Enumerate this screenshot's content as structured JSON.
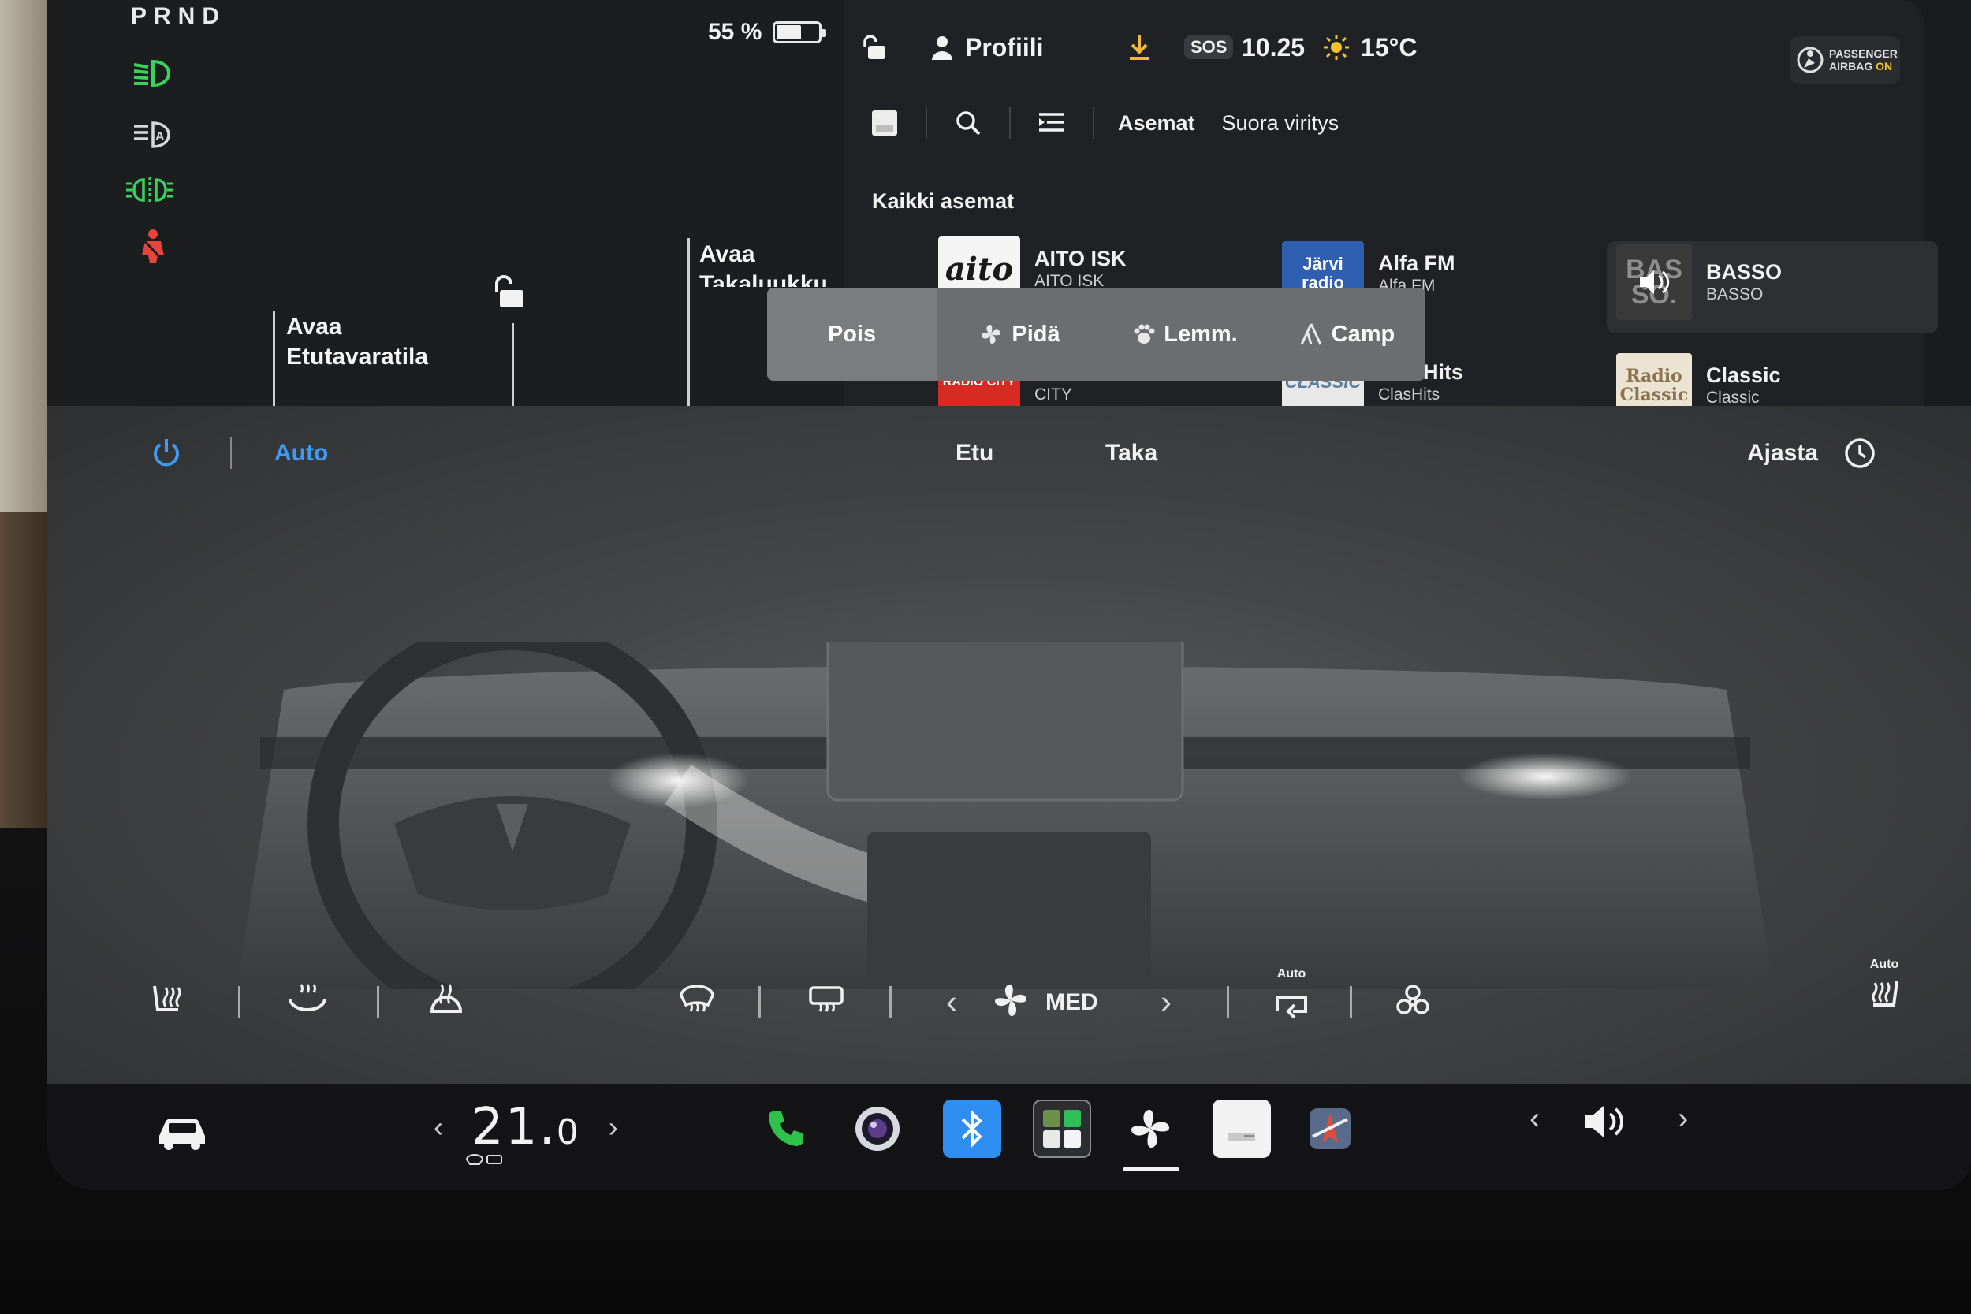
{
  "gear": "PRND",
  "battery": {
    "percent_label": "55 %",
    "level": 0.55
  },
  "status_bar": {
    "profile_label": "Profiili",
    "sos_label": "SOS",
    "time": "10.25",
    "temperature": "15°C",
    "airbag_line1": "PASSENGER",
    "airbag_line2_prefix": "AIRBAG",
    "airbag_line2_state": "ON"
  },
  "car": {
    "frunk_label": "Avaa Etutavaratila",
    "trunk_label": "Avaa Takaluukku"
  },
  "media": {
    "tabs": [
      "Asemat",
      "Suora viritys"
    ],
    "section_title": "Kaikki asemat",
    "stations": [
      {
        "name": "AITO ISK",
        "sub": "AITO ISK",
        "logo": "aito"
      },
      {
        "name": "Alfa FM",
        "sub": "Alfa FM",
        "logo": "Järvi radio"
      },
      {
        "name": "BASSO",
        "sub": "BASSO",
        "logo": "BAS SO."
      },
      {
        "name": "CITY",
        "sub": "CITY",
        "logo": "RADIO CITY"
      },
      {
        "name": "ClasHits",
        "sub": "ClasHits",
        "logo": "CLASSIC"
      },
      {
        "name": "Classic",
        "sub": "Classic",
        "logo": "Radio Classic"
      }
    ]
  },
  "climate_modes": [
    "Pois",
    "Pidä",
    "Lemm.",
    "Camp"
  ],
  "climate": {
    "auto_label": "Auto",
    "front_label": "Etu",
    "rear_label": "Taka",
    "schedule_label": "Ajasta",
    "fan_speed": "MED",
    "recirc_auto_label": "Auto",
    "seat_auto_label": "Auto"
  },
  "dock": {
    "temperature_main": "21.",
    "temperature_decimal": "0"
  },
  "colors": {
    "accent_blue": "#3d9af5",
    "headlight_green": "#38d35a",
    "seatbelt_red": "#e5453d",
    "phone_green": "#2fc24a",
    "bluetooth_blue": "#2e8ff0"
  }
}
